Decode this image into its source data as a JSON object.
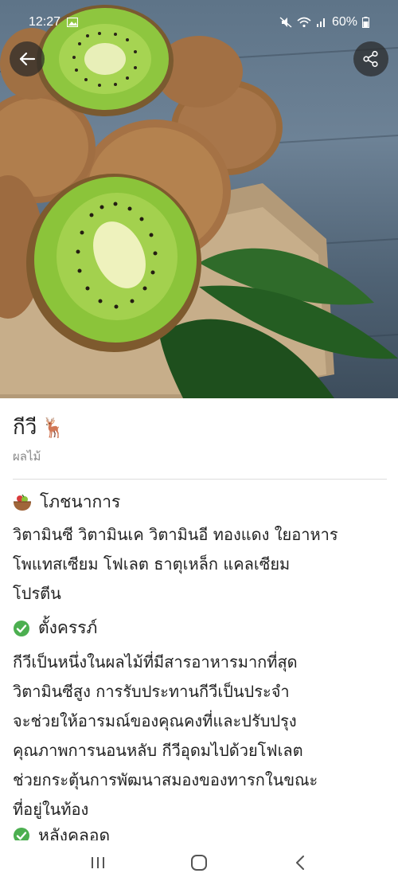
{
  "status_bar": {
    "time": "12:27",
    "battery": "60%",
    "icons": [
      "gallery-icon",
      "mute-icon",
      "wifi-icon",
      "signal-icon",
      "battery-icon"
    ]
  },
  "header": {
    "back_icon": "arrow-left-icon",
    "share_icon": "share-icon"
  },
  "item": {
    "title": "กีวี",
    "title_emoji": "🦌",
    "category": "ผลไม้"
  },
  "sections": [
    {
      "icon": "food-bowl-icon",
      "title": "โภชนาการ",
      "body_lines": [
        "วิตามินซี วิตามินเค วิตามินอี ทองแดง ใยอาหาร",
        "โพแทสเซียม โฟเลต  ธาตุเหล็ก แคลเซียม",
        "โปรตีน"
      ]
    },
    {
      "icon": "check-circle-icon",
      "title": "ตั้งครรภ์",
      "body_lines": [
        "กีวีเป็นหนึ่งในผลไม้ที่มีสารอาหารมากที่สุด",
        "วิตามินซีสูง การรับประทานกีวีเป็นประจำ",
        "จะช่วยให้อารมณ์ของคุณคงที่และปรับปรุง",
        "คุณภาพการนอนหลับ กีวีอุดมไปด้วยโฟเลต",
        "ช่วยกระตุ้นการพัฒนาสมองของทารกในขณะ",
        "ที่อยู่ในท้อง"
      ]
    },
    {
      "icon": "check-circle-icon",
      "title": "หลังคลอด"
    }
  ],
  "colors": {
    "accent_green": "#4caf50",
    "overlay_button": "#2e2e2e",
    "divider": "#dddddd",
    "subtitle_gray": "#888888"
  },
  "nav_bar": {
    "items": [
      "recent-apps-icon",
      "home-icon",
      "back-icon"
    ]
  }
}
